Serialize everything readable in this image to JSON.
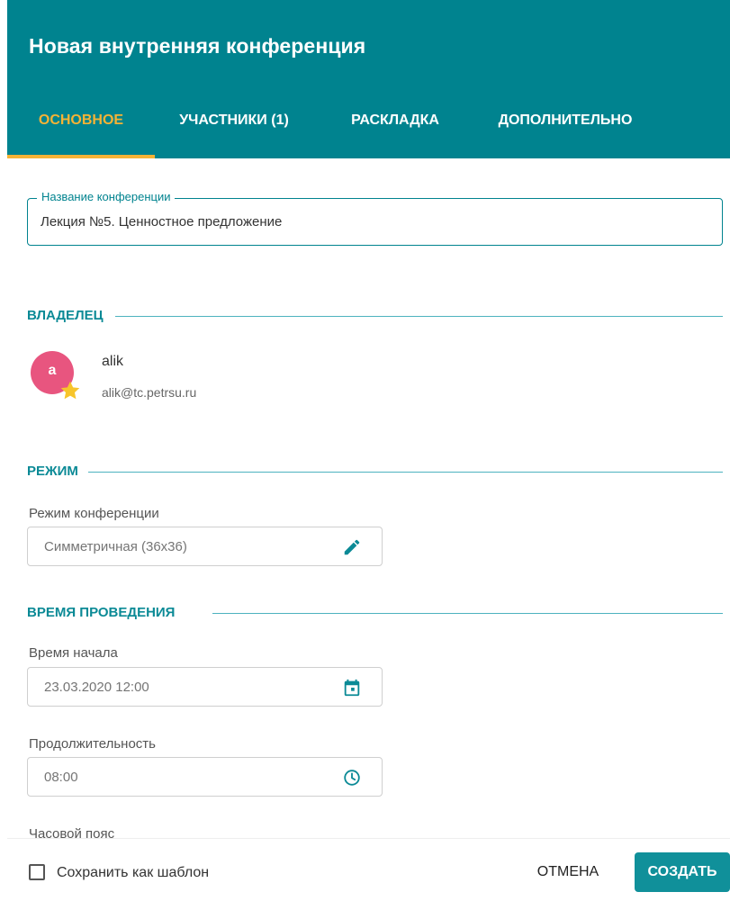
{
  "dialog": {
    "title": "Новая внутренняя конференция"
  },
  "tabs": [
    {
      "label": "ОСНОВНОЕ",
      "active": true
    },
    {
      "label": "УЧАСТНИКИ (1)",
      "active": false
    },
    {
      "label": "РАСКЛАДКА",
      "active": false
    },
    {
      "label": "ДОПОЛНИТЕЛЬНО",
      "active": false
    }
  ],
  "conference_name": {
    "label": "Название конференции",
    "value": "Лекция №5. Ценностное предложение"
  },
  "owner": {
    "section_title": "ВЛАДЕЛЕЦ",
    "avatar_letter": "a",
    "name": "alik",
    "email": "alik@tc.petrsu.ru"
  },
  "mode": {
    "section_title": "РЕЖИМ",
    "label": "Режим конференции",
    "value": "Симметричная (36x36)",
    "icon": "pencil-icon"
  },
  "schedule": {
    "section_title": "ВРЕМЯ ПРОВЕДЕНИЯ",
    "start_label": "Время начала",
    "start_value": "23.03.2020 12:00",
    "start_icon": "calendar-icon",
    "duration_label": "Продолжительность",
    "duration_value": "08:00",
    "duration_icon": "clock-icon",
    "timezone_label": "Часовой пояс"
  },
  "footer": {
    "save_template_label": "Сохранить как шаблон",
    "save_template_checked": false,
    "cancel_label": "ОТМЕНА",
    "create_label": "СОЗДАТЬ"
  },
  "colors": {
    "header": "#00838f",
    "accent": "#f5b335",
    "section": "#0b8a96",
    "avatar": "#e8557f",
    "primary_button": "#10909a"
  }
}
